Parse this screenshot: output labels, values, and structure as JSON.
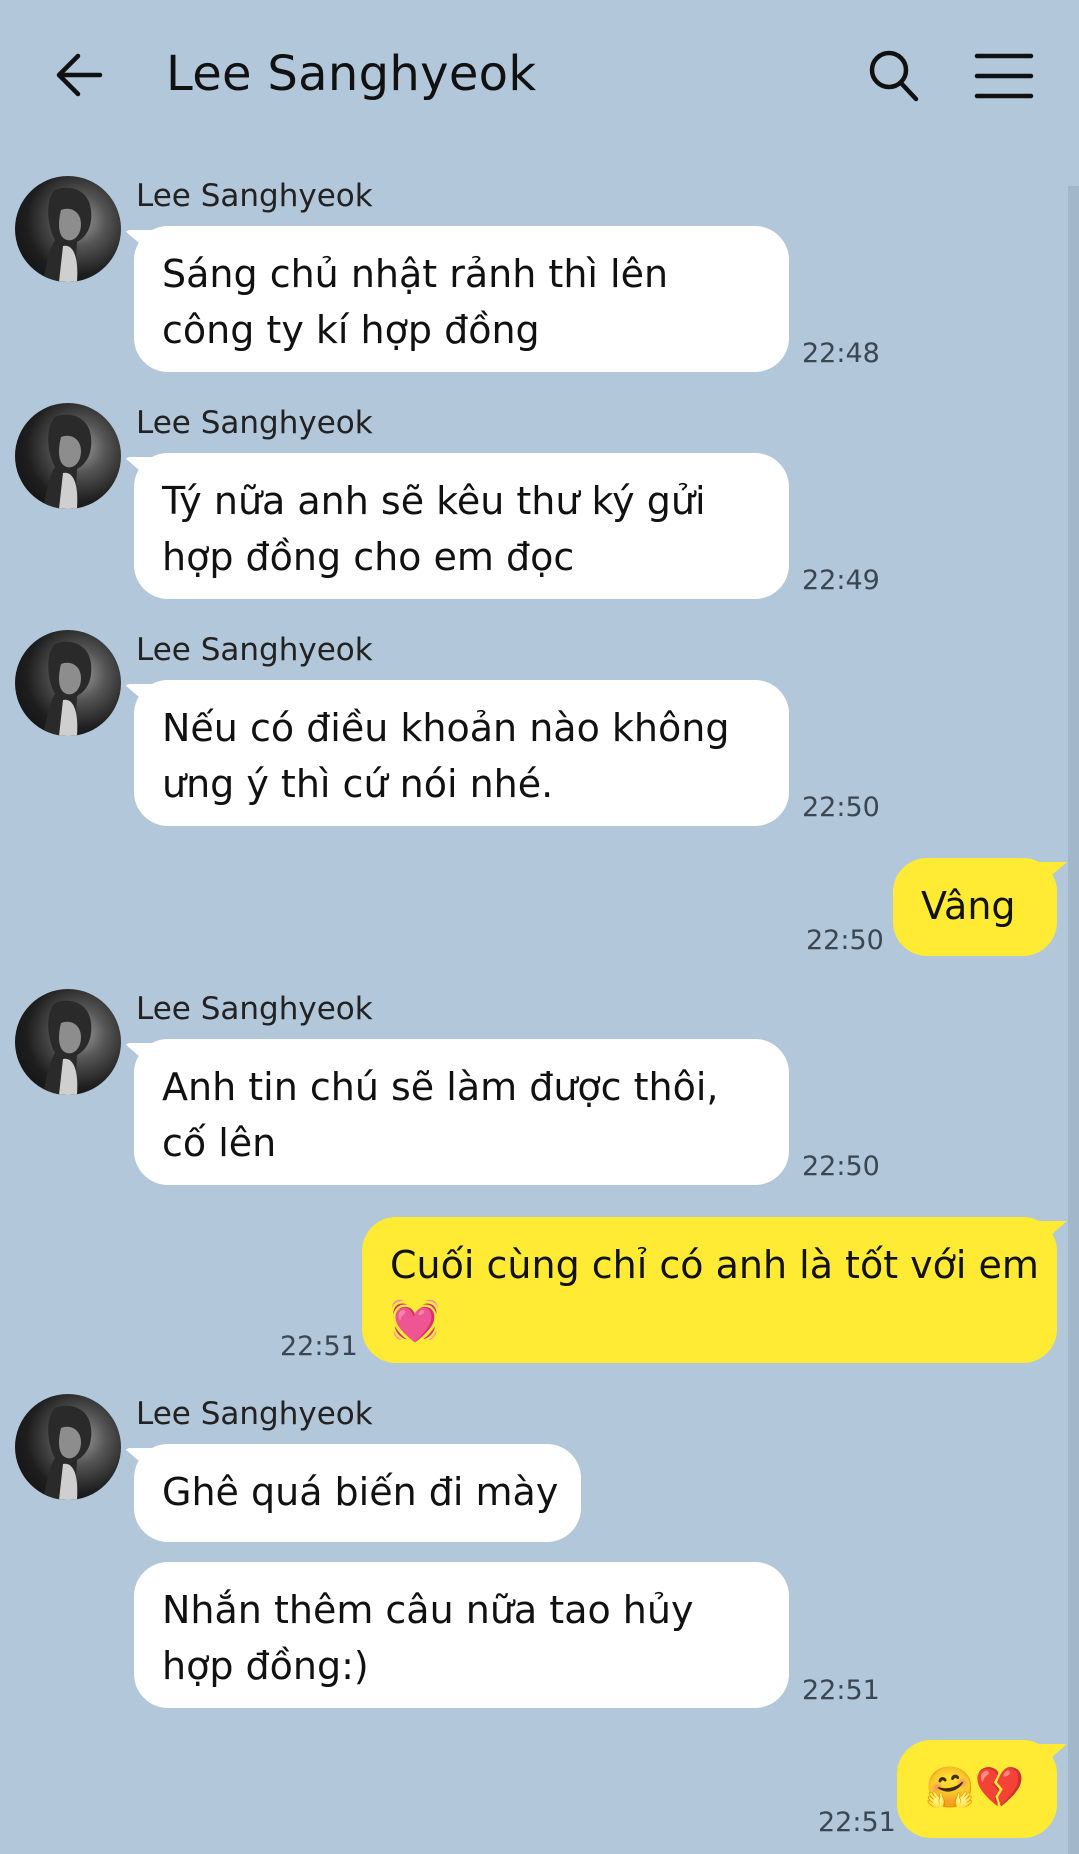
{
  "header": {
    "title": "Lee Sanghyeok"
  },
  "messages": [
    {
      "sender": "Lee Sanghyeok",
      "lines": [
        "Sáng chủ nhật rảnh thì lên",
        "công ty kí hợp đồng"
      ],
      "time": "22:48"
    },
    {
      "sender": "Lee Sanghyeok",
      "lines": [
        "Tý nữa anh sẽ kêu thư ký gửi",
        "hợp đồng cho em đọc"
      ],
      "time": "22:49"
    },
    {
      "sender": "Lee Sanghyeok",
      "lines": [
        "Nếu có điều khoản nào không",
        "ưng ý thì cứ nói nhé."
      ],
      "time": "22:50"
    },
    {
      "outgoing": true,
      "lines": [
        "Vâng"
      ],
      "time": "22:50"
    },
    {
      "sender": "Lee Sanghyeok",
      "lines": [
        "Anh tin chú sẽ làm được thôi,",
        "cố lên"
      ],
      "time": "22:50"
    },
    {
      "outgoing": true,
      "lines": [
        "Cuối cùng chỉ có anh là tốt với em",
        "💓"
      ],
      "time": "22:51"
    },
    {
      "sender": "Lee Sanghyeok",
      "lines": [
        "Ghê quá biến đi mày"
      ]
    },
    {
      "lines": [
        "Nhắn thêm câu nữa tao hủy",
        "hợp đồng:)"
      ],
      "time": "22:51"
    },
    {
      "outgoing": true,
      "lines": [
        "🤗💔"
      ],
      "time": "22:51"
    }
  ],
  "colors": {
    "background": "#b2c7da",
    "incoming_bubble": "#ffffff",
    "outgoing_bubble": "#ffeb33"
  },
  "icons": [
    "back-arrow-icon",
    "search-icon",
    "menu-icon"
  ]
}
